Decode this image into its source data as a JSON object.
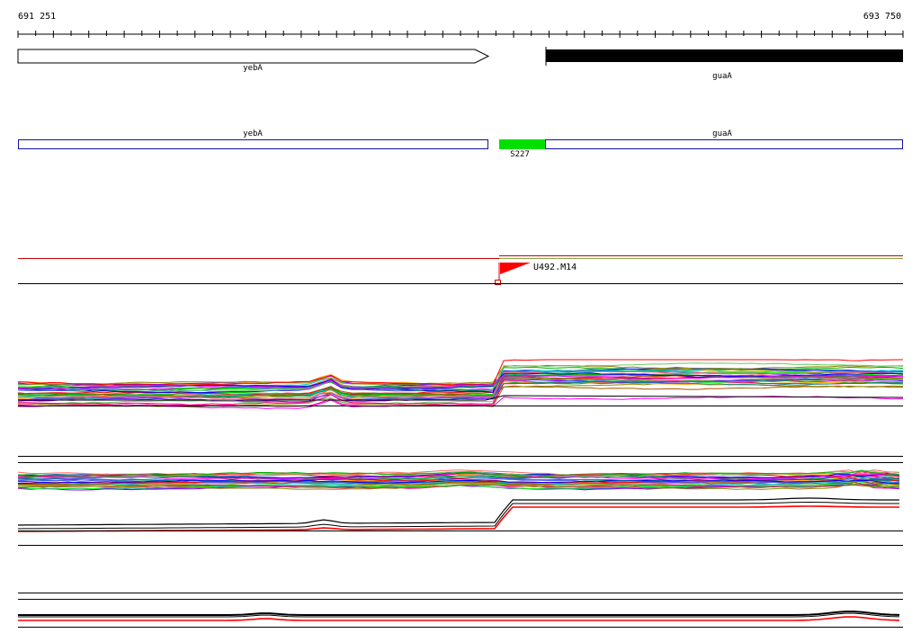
{
  "ruler": {
    "start": "691 251",
    "end": "693 750"
  },
  "annotation_track": {
    "genes": [
      {
        "name": "yebA",
        "strand": "forward",
        "fill": "#ffffff"
      },
      {
        "name": "guaA",
        "strand": "reverse",
        "fill": "#000000"
      }
    ]
  },
  "feature_track": {
    "genes": [
      {
        "name": "yebA",
        "outline": "#1010a0"
      },
      {
        "name": "guaA",
        "outline": "#1010a0"
      }
    ],
    "highlight": {
      "label": "S227",
      "color": "#00e000"
    }
  },
  "marker_track": {
    "flag_label": "U492.M14",
    "flag_color": "#ff0000",
    "line_color": "#cc0000"
  },
  "colors": {
    "reference_line": "#000000",
    "highlight_line": "#ff0000",
    "profile_palette": [
      "#ff0000",
      "#00aa00",
      "#0000ff",
      "#ff00ff",
      "#00cccc",
      "#ffaa00",
      "#8800ff",
      "#00ff00",
      "#aa5500",
      "#ff0088",
      "#008888",
      "#888800",
      "#5555ff",
      "#ff6666",
      "#66cc66"
    ]
  }
}
